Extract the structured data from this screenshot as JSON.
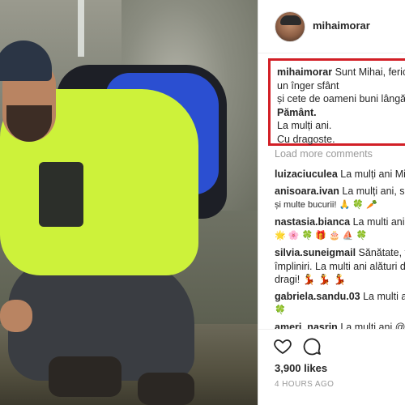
{
  "post": {
    "username": "mihaimorar",
    "caption": {
      "author": "mihaimorar",
      "line1": "Sunt Mihai, feric",
      "line2": "un înger sfânt",
      "line3": "și cete de oameni buni lângă",
      "line4": "Pământ.",
      "line5": "La mulți ani.",
      "line6": "Cu dragoste."
    },
    "load_more": "Load more comments",
    "comments": [
      {
        "user": "luizaciuculea",
        "l1": "La mulți ani Mih",
        "l2": ""
      },
      {
        "user": "anisoara.ivan",
        "l1": "La mulți ani, san",
        "l2": "și multe bucurii! 🙏 🍀 🥕"
      },
      {
        "user": "nastasia.bianca",
        "l1": "La multi ani, F",
        "l2": "🌟 🌸 🍀 🎁 🎂 ⛵ 🍀"
      },
      {
        "user": "silvia.suneigmail",
        "l1": "Sănătate, fe",
        "l2": "împliniri. La multi ani alături d",
        "l3": "dragi! 💃 💃 💃"
      },
      {
        "user": "gabriela.sandu.03",
        "l1": "La multi an",
        "l2": "🍀"
      },
      {
        "user": "ameri_nasrin",
        "l1": "La multi ani @",
        "l2": ""
      }
    ],
    "likes": "3,900 likes",
    "timestamp": "4 HOURS AGO"
  },
  "icons": {
    "like": "heart-icon",
    "comment": "comment-bubble-icon"
  }
}
